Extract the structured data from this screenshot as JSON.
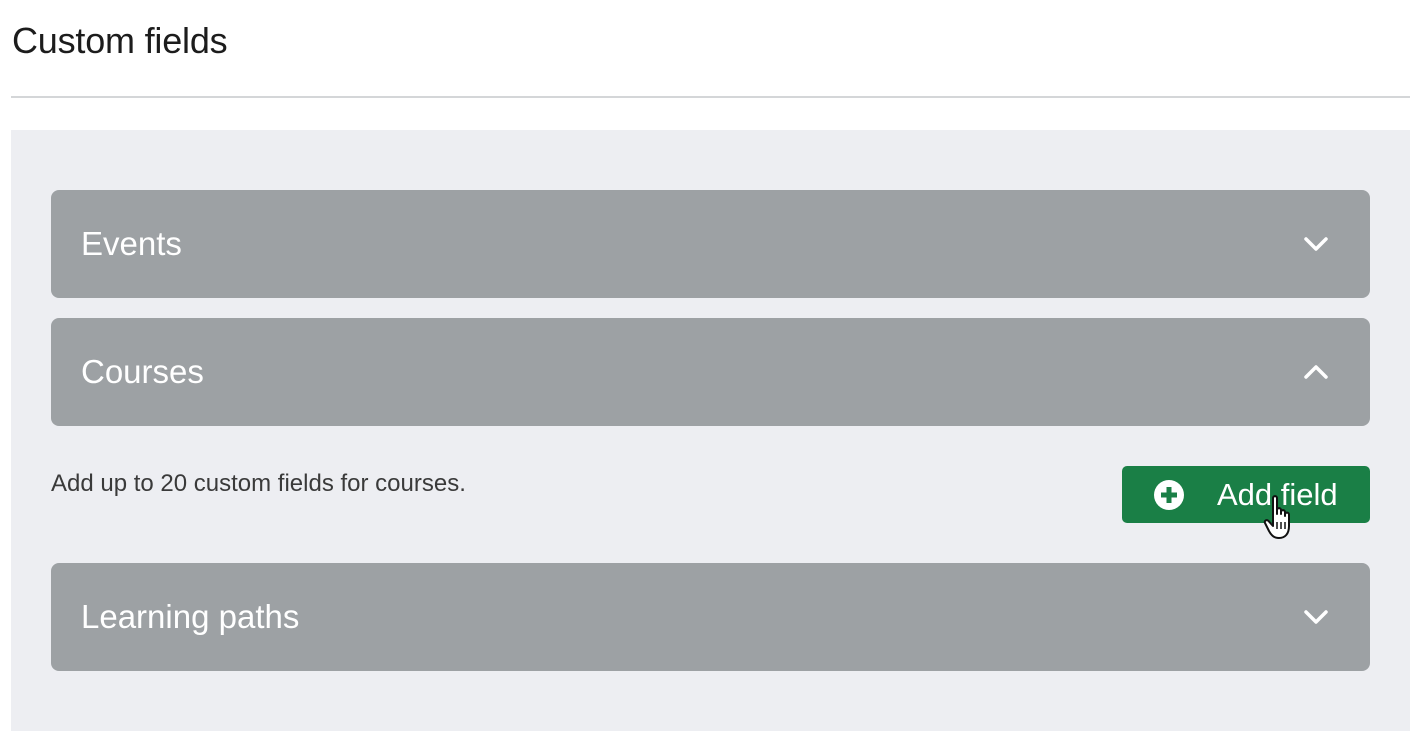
{
  "page": {
    "title": "Custom fields"
  },
  "sections": [
    {
      "label": "Events",
      "expanded": false,
      "chevron": "chevron-down-icon"
    },
    {
      "label": "Courses",
      "expanded": true,
      "chevron": "chevron-up-icon",
      "description": "Add up to 20 custom fields for courses.",
      "add_button_label": "Add field",
      "add_button_icon": "plus-circle-icon"
    },
    {
      "label": "Learning paths",
      "expanded": false,
      "chevron": "chevron-down-icon"
    }
  ],
  "colors": {
    "accordion_bg": "#9da1a4",
    "panel_bg": "#edeef2",
    "primary_button": "#1a7f46"
  },
  "cursor": "hand-pointer-icon"
}
